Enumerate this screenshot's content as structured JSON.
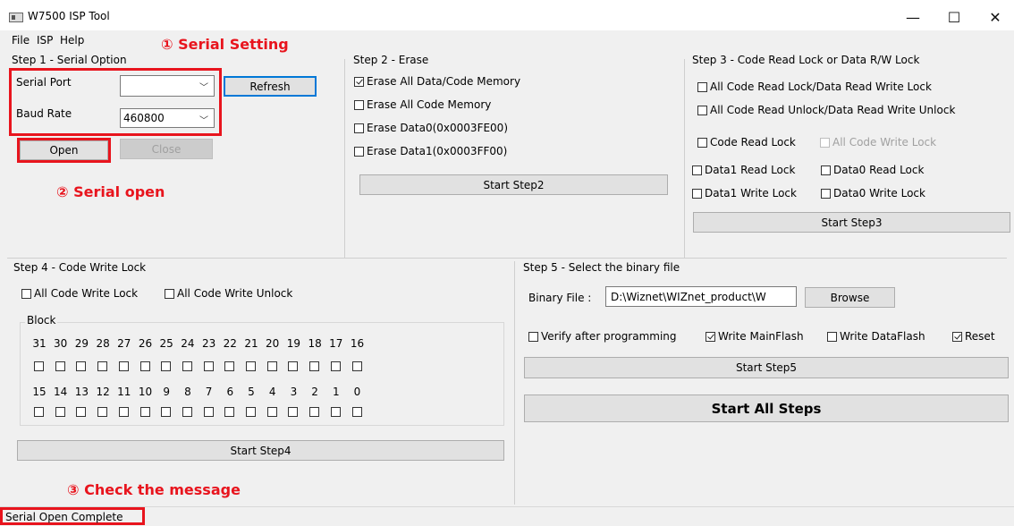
{
  "window": {
    "title": "W7500 ISP Tool",
    "minimize": "—",
    "maximize": "☐",
    "close": "✕"
  },
  "menu": [
    "File",
    "ISP",
    "Help"
  ],
  "annotations": {
    "serial_setting": "① Serial Setting",
    "serial_open": "② Serial open",
    "check_message": "③ Check the message",
    "color": "#e8141d"
  },
  "step1": {
    "title": "Step 1 - Serial Option",
    "serial_port_label": "Serial Port",
    "serial_port_value": "",
    "baud_rate_label": "Baud Rate",
    "baud_rate_value": "460800",
    "refresh": "Refresh",
    "open": "Open",
    "close": "Close"
  },
  "step2": {
    "title": "Step 2 - Erase",
    "options": [
      {
        "label": "Erase All Data/Code Memory",
        "checked": true
      },
      {
        "label": "Erase All Code Memory",
        "checked": false
      },
      {
        "label": "Erase Data0(0x0003FE00)",
        "checked": false
      },
      {
        "label": "Erase Data1(0x0003FF00)",
        "checked": false
      }
    ],
    "start": "Start Step2"
  },
  "step3": {
    "title": "Step 3 - Code Read Lock or Data R/W Lock",
    "all_lock": "All Code Read Lock/Data Read Write Lock",
    "all_unlock": "All Code Read Unlock/Data Read Write Unlock",
    "code_read_lock": "Code Read Lock",
    "all_code_write_lock": "All Code Write Lock",
    "data1_read_lock": "Data1 Read Lock",
    "data0_read_lock": "Data0 Read Lock",
    "data1_write_lock": "Data1 Write Lock",
    "data0_write_lock": "Data0 Write Lock",
    "start": "Start Step3"
  },
  "step4": {
    "title": "Step 4 - Code Write Lock",
    "all_write_lock": "All Code Write Lock",
    "all_write_unlock": "All Code Write Unlock",
    "block_label": "Block",
    "row1": [
      "31",
      "30",
      "29",
      "28",
      "27",
      "26",
      "25",
      "24",
      "23",
      "22",
      "21",
      "20",
      "19",
      "18",
      "17",
      "16"
    ],
    "row2": [
      "15",
      "14",
      "13",
      "12",
      "11",
      "10",
      "9",
      "8",
      "7",
      "6",
      "5",
      "4",
      "3",
      "2",
      "1",
      "0"
    ],
    "start": "Start Step4"
  },
  "step5": {
    "title": "Step 5 - Select the binary file",
    "binary_label": "Binary File :",
    "binary_value": "D:\\Wiznet\\WIZnet_product\\W",
    "browse": "Browse",
    "verify": "Verify after programming",
    "write_main": "Write MainFlash",
    "write_data": "Write DataFlash",
    "reset": "Reset",
    "start": "Start Step5",
    "start_all": "Start All Steps"
  },
  "status": "Serial Open Complete"
}
